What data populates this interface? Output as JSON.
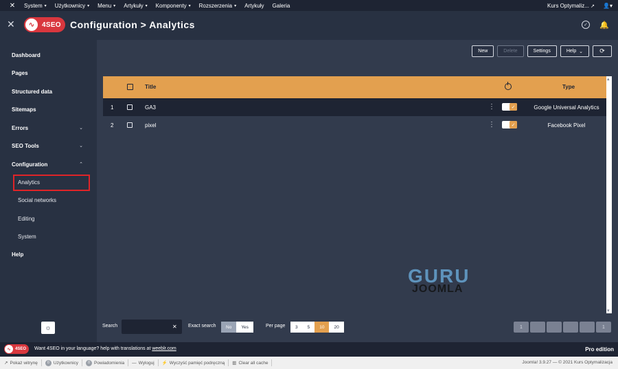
{
  "topbar": {
    "menu": [
      {
        "label": "System"
      },
      {
        "label": "Użytkownicy"
      },
      {
        "label": "Menu"
      },
      {
        "label": "Artykuły"
      },
      {
        "label": "Komponenty"
      },
      {
        "label": "Rozszerzenia"
      },
      {
        "label": "Artykuły"
      },
      {
        "label": "Galeria"
      }
    ],
    "site_link": "Kurs Optymaliz..."
  },
  "header": {
    "brand": "4SEO",
    "title": "Configuration > Analytics"
  },
  "sidebar": {
    "items": [
      {
        "label": "Dashboard"
      },
      {
        "label": "Pages"
      },
      {
        "label": "Structured data"
      },
      {
        "label": "Sitemaps"
      },
      {
        "label": "Errors"
      },
      {
        "label": "SEO Tools"
      },
      {
        "label": "Configuration"
      }
    ],
    "subitems": [
      {
        "label": "Analytics",
        "active": true
      },
      {
        "label": "Social networks"
      },
      {
        "label": "Editing"
      },
      {
        "label": "System"
      }
    ],
    "help": "Help"
  },
  "toolbar": {
    "new": "New",
    "delete": "Delete",
    "settings": "Settings",
    "help": "Help"
  },
  "table": {
    "col_title": "Title",
    "col_type": "Type",
    "rows": [
      {
        "num": "1",
        "title": "GA3",
        "type": "Google Universal Analytics",
        "enabled": true
      },
      {
        "num": "2",
        "title": "pixel",
        "type": "Facebook Pixel",
        "enabled": true
      }
    ]
  },
  "filters": {
    "search_label": "Search",
    "search_value": "",
    "search_placeholder": "",
    "exact_label": "Exact search",
    "exact_options": [
      "No",
      "Yes"
    ],
    "exact_selected": "No",
    "perpage_label": "Per page",
    "perpage_options": [
      "3",
      "5",
      "10",
      "20"
    ],
    "perpage_selected": "10",
    "pager": [
      "1",
      "1"
    ]
  },
  "watermark": {
    "line1": "GURU",
    "line2": "JOOMLA"
  },
  "footer": {
    "promo_text": "Want 4SEO in your language? help with translations at ",
    "promo_link": "weeblr.com",
    "edition": "Pro edition"
  },
  "statusbar": {
    "items": [
      {
        "label": "Pokaż witrynę",
        "badge": ""
      },
      {
        "label": "Użytkownicy",
        "badge": "0"
      },
      {
        "label": "Powiadomienia",
        "badge": "0"
      },
      {
        "label": "Wyloguj",
        "badge": ""
      },
      {
        "label": "Wyczyść pamięć podręczną",
        "badge": ""
      },
      {
        "label": "Clear all cache",
        "badge": ""
      }
    ],
    "version": "Joomla! 3.9.27 — © 2021 Kurs Optymalizacja"
  },
  "colors": {
    "accent": "#e3a04f",
    "brand_red": "#d9373e",
    "sidebar_bg": "#283142",
    "main_bg": "#323b4d"
  },
  "icons": [
    "joomla-icon",
    "close-icon",
    "check-circle-icon",
    "bell-icon",
    "power-icon",
    "kebab-icon",
    "sun-icon",
    "refresh-icon",
    "chevron-down-icon",
    "chevron-up-icon"
  ]
}
